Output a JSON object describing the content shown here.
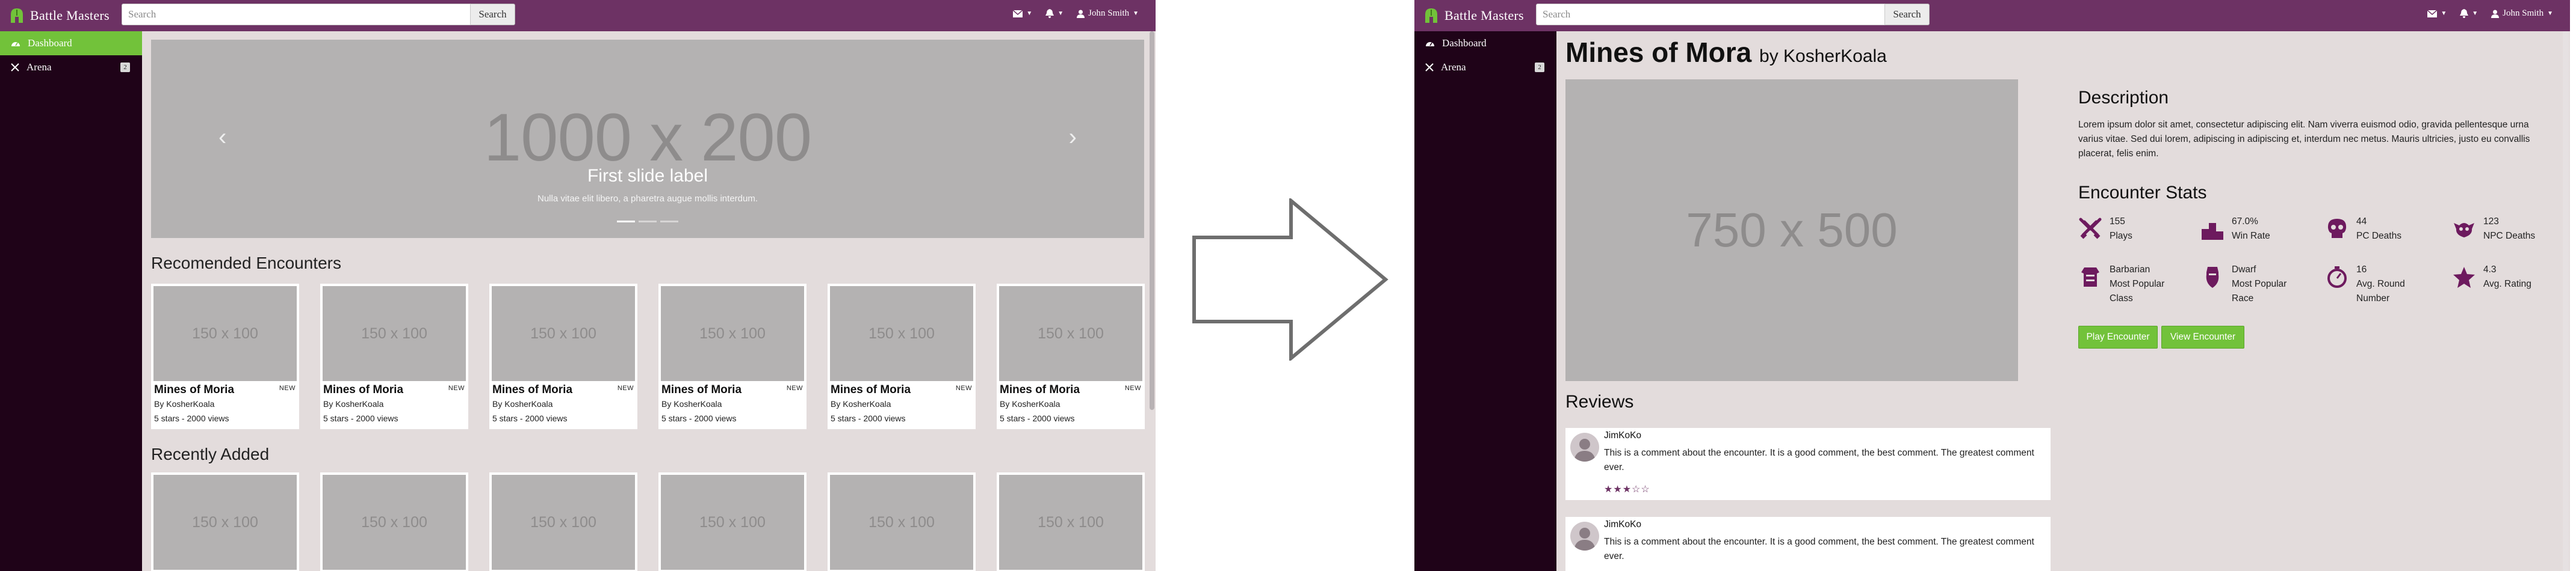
{
  "app": {
    "name": "Battle Masters",
    "search_placeholder": "Search",
    "search_button": "Search",
    "user_name": "John Smith",
    "sidebar": [
      {
        "label": "Dashboard",
        "icon": "dashboard-icon"
      },
      {
        "label": "Arena",
        "icon": "arena-icon",
        "badge": "2"
      }
    ]
  },
  "left": {
    "carousel": {
      "big_text": "1000 x 200",
      "caption": "First slide label",
      "sub": "Nulla vitae elit libero, a pharetra augue mollis interdum.",
      "active_slide": 1,
      "slide_count": 3
    },
    "recommended_title": "Recomended Encounters",
    "recommended": [
      {
        "img": "150 x 100",
        "title": "Mines of Moria",
        "badge": "NEW",
        "by": "By KosherKoala",
        "stats": "5 stars - 2000 views"
      },
      {
        "img": "150 x 100",
        "title": "Mines of Moria",
        "badge": "NEW",
        "by": "By KosherKoala",
        "stats": "5 stars - 2000 views"
      },
      {
        "img": "150 x 100",
        "title": "Mines of Moria",
        "badge": "NEW",
        "by": "By KosherKoala",
        "stats": "5 stars - 2000 views"
      },
      {
        "img": "150 x 100",
        "title": "Mines of Moria",
        "badge": "NEW",
        "by": "By KosherKoala",
        "stats": "5 stars - 2000 views"
      },
      {
        "img": "150 x 100",
        "title": "Mines of Moria",
        "badge": "NEW",
        "by": "By KosherKoala",
        "stats": "5 stars - 2000 views"
      },
      {
        "img": "150 x 100",
        "title": "Mines of Moria",
        "badge": "NEW",
        "by": "By KosherKoala",
        "stats": "5 stars - 2000 views"
      }
    ],
    "recent_title": "Recently Added",
    "recent": [
      {
        "img": "150 x 100"
      },
      {
        "img": "150 x 100"
      },
      {
        "img": "150 x 100"
      },
      {
        "img": "150 x 100"
      },
      {
        "img": "150 x 100"
      },
      {
        "img": "150 x 100"
      }
    ]
  },
  "right": {
    "title": "Mines of Mora",
    "by": "by KosherKoala",
    "image": "750 x 500",
    "description_title": "Description",
    "description": "Lorem ipsum dolor sit amet, consectetur adipiscing elit. Nam viverra euismod odio, gravida pellentesque urna varius vitae. Sed dui lorem, adipiscing in adipiscing et, interdum nec metus. Mauris ultricies, justo eu convallis placerat, felis enim.",
    "stats_title": "Encounter Stats",
    "stats": [
      {
        "icon": "crossed-swords-icon",
        "value": "155",
        "label": "Plays"
      },
      {
        "icon": "podium-icon",
        "value": "67.0%",
        "label": "Win Rate"
      },
      {
        "icon": "skull-icon",
        "value": "44",
        "label": "PC Deaths"
      },
      {
        "icon": "dragon-skull-icon",
        "value": "123",
        "label": "NPC Deaths"
      },
      {
        "icon": "armor-icon",
        "value": "Barbarian",
        "label": "Most Popular Class"
      },
      {
        "icon": "dwarf-icon",
        "value": "Dwarf",
        "label": "Most Popular Race"
      },
      {
        "icon": "stopwatch-icon",
        "value": "16",
        "label": "Avg. Round Number"
      },
      {
        "icon": "star-icon",
        "value": "4.3",
        "label": "Avg. Rating"
      }
    ],
    "play_button": "Play Encounter",
    "view_button": "View Encounter",
    "reviews_title": "Reviews",
    "reviews": [
      {
        "name": "JimKoKo",
        "text": "This is a comment about the encounter. It is a good comment, the best comment. The greatest comment ever.",
        "rating": 3,
        "stars": "★★★☆☆"
      },
      {
        "name": "JimKoKo",
        "text": "This is a comment about the encounter. It is a good comment, the best comment. The greatest comment ever."
      }
    ]
  },
  "colors": {
    "navbar": "#6d3264",
    "sidebar": "#1f0318",
    "accent": "#72c23a",
    "content_bg": "#e3dcdc",
    "placeholder": "#b4b2b2"
  }
}
